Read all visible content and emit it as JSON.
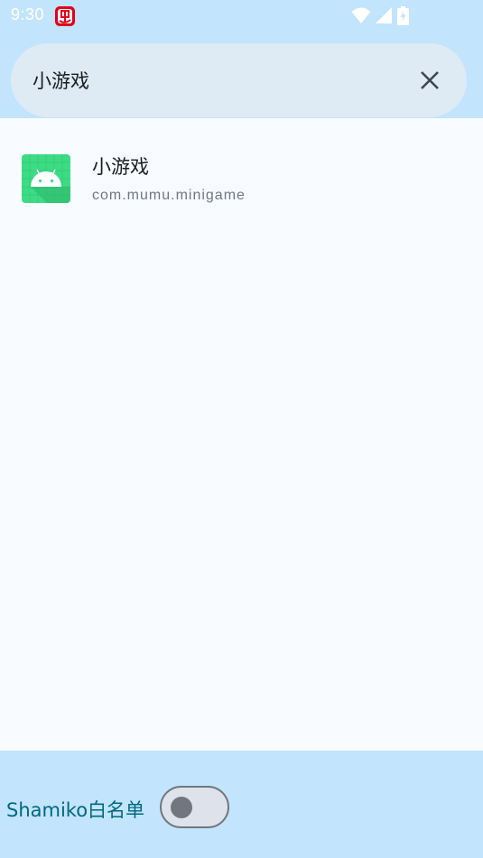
{
  "status_bar": {
    "time": "9:30",
    "app_icon": "shamiko-app-icon",
    "wifi_icon": "wifi-icon",
    "signal_icon": "cell-signal-icon",
    "battery_icon": "battery-charging-icon"
  },
  "search": {
    "query": "小游戏",
    "clear_icon": "close-icon"
  },
  "results": [
    {
      "name": "小游戏",
      "package": "com.mumu.minigame",
      "icon": "android-icon"
    }
  ],
  "bottom": {
    "whitelist_label": "Shamiko白名单",
    "whitelist_enabled": false
  },
  "colors": {
    "header_bg": "#c2e4fc",
    "search_pill_bg": "#deebf4",
    "list_bg": "#f8fbff",
    "accent_text": "#006780",
    "android_green": "#3ddc84"
  }
}
